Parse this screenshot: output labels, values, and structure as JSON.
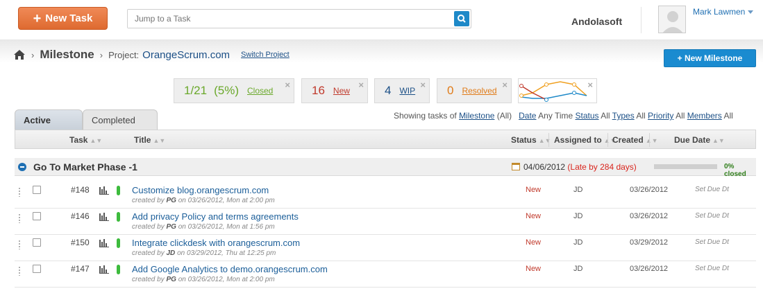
{
  "header": {
    "new_task_label": "New Task",
    "jump_placeholder": "Jump to a Task",
    "company": "Andolasoft",
    "user_name": "Mark Lawmen"
  },
  "breadcrumb": {
    "section": "Milestone",
    "project_label": "Project:",
    "project_name": "OrangeScrum.com",
    "switch_label": "Switch Project"
  },
  "new_milestone_label": "+ New Milestone",
  "stats": {
    "closed_count": "1/21",
    "closed_pct": "(5%)",
    "closed_label": "Closed",
    "new_count": "16",
    "new_label": "New",
    "wip_count": "4",
    "wip_label": "WIP",
    "resolved_count": "0",
    "resolved_label": "Resolved"
  },
  "tabs": {
    "active": "Active",
    "completed": "Completed"
  },
  "filters": {
    "prefix": "Showing tasks of",
    "milestone": "Milestone",
    "milestone_val": "(All)",
    "date": "Date",
    "date_val": "Any Time",
    "status": "Status",
    "status_val": "All",
    "types": "Types",
    "types_val": "All",
    "priority": "Priority",
    "priority_val": "All",
    "members": "Members",
    "members_val": "All"
  },
  "columns": {
    "task": "Task",
    "title": "Title",
    "status": "Status",
    "assigned": "Assigned to",
    "created": "Created",
    "due": "Due Date"
  },
  "group": {
    "title": "Go To Market Phase -1",
    "date": "04/06/2012",
    "late": "(Late by 284 days)",
    "progress_pct": 0,
    "progress_label": "0% closed"
  },
  "tasks": [
    {
      "no": "#148",
      "title": "Customize blog.orangescrum.com",
      "meta_pre": "created by",
      "by": "PG",
      "meta_post": "on 03/26/2012, Mon at 2:00 pm",
      "status": "New",
      "assigned": "JD",
      "created": "03/26/2012",
      "due": "Set Due Dt"
    },
    {
      "no": "#146",
      "title": "Add privacy Policy and terms agreements",
      "meta_pre": "created by",
      "by": "PG",
      "meta_post": "on 03/26/2012, Mon at 1:56 pm",
      "status": "New",
      "assigned": "JD",
      "created": "03/26/2012",
      "due": "Set Due Dt"
    },
    {
      "no": "#150",
      "title": "Integrate clickdesk with orangescrum.com",
      "meta_pre": "created by",
      "by": "JD",
      "meta_post": "on 03/29/2012, Thu at 12:25 pm",
      "status": "New",
      "assigned": "JD",
      "created": "03/29/2012",
      "due": "Set Due Dt"
    },
    {
      "no": "#147",
      "title": "Add Google Analytics to demo.orangescrum.com",
      "meta_pre": "created by",
      "by": "PG",
      "meta_post": "on 03/26/2012, Mon at 2:00 pm",
      "status": "New",
      "assigned": "JD",
      "created": "03/26/2012",
      "due": "Set Due Dt"
    }
  ],
  "colors": {
    "orange": "#de6a30",
    "blue": "#1a8bd0",
    "closed_green": "#6aa82a",
    "new_red": "#c0392b",
    "wip_blue": "#1b4f86",
    "resolved_orange": "#e07b18"
  }
}
